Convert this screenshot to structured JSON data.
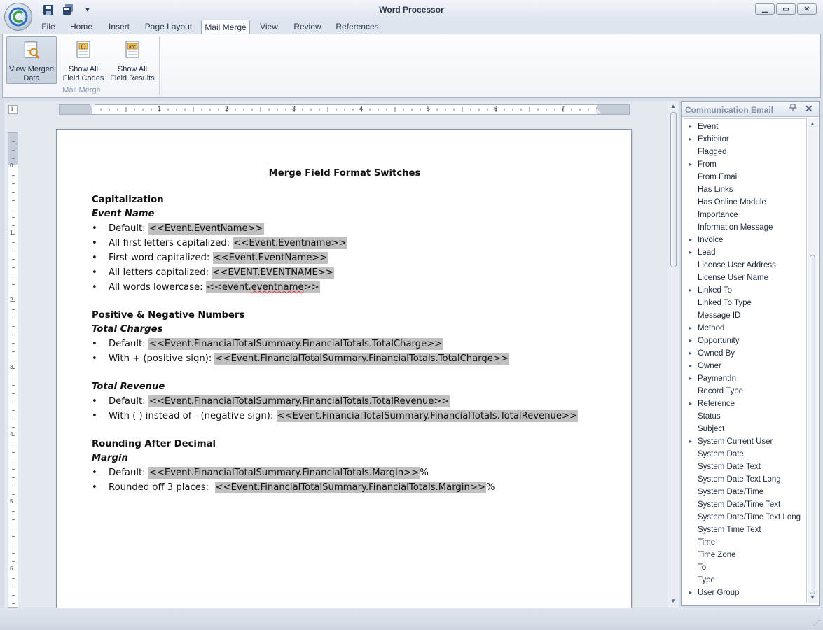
{
  "app": {
    "title": "Word Processor"
  },
  "tabs": [
    {
      "label": "File"
    },
    {
      "label": "Home"
    },
    {
      "label": "Insert"
    },
    {
      "label": "Page Layout"
    },
    {
      "label": "Mail Merge"
    },
    {
      "label": "View"
    },
    {
      "label": "Review"
    },
    {
      "label": "References"
    }
  ],
  "active_tab": "Mail Merge",
  "ribbon": {
    "group_label": "Mail Merge",
    "buttons": [
      {
        "line1": "View Merged",
        "line2": "Data"
      },
      {
        "line1": "Show All",
        "line2": "Field Codes"
      },
      {
        "line1": "Show All",
        "line2": "Field Results"
      }
    ]
  },
  "ruler": {
    "h_numbers": [
      "1",
      "2",
      "3",
      "4",
      "5",
      "6",
      "7"
    ],
    "v_numbers": [
      "0",
      "1",
      "2",
      "3",
      "4",
      "5",
      "6"
    ],
    "corner": "L"
  },
  "document": {
    "title": "Merge Field Format Switches",
    "sections": [
      {
        "heading": "Capitalization",
        "subheading": "Event Name",
        "bullets": [
          {
            "text": "Default: ",
            "field": "<<Event.EventName>>",
            "suffix": ""
          },
          {
            "text": "All first letters capitalized: ",
            "field": "<<Event.Eventname>>",
            "suffix": ""
          },
          {
            "text": "First word capitalized: ",
            "field": "<<Event.EventName>>",
            "suffix": ""
          },
          {
            "text": "All letters capitalized: ",
            "field": "<<EVENT.EVENTNAME>>",
            "suffix": ""
          },
          {
            "text": "All words lowercase: ",
            "field_pre": "<<event.",
            "field_err": "eventname",
            "field_post": ">>",
            "suffix": ""
          }
        ]
      },
      {
        "heading": "Positive & Negative Numbers",
        "subheading": "Total Charges",
        "bullets": [
          {
            "text": "Default: ",
            "field": "<<Event.FinancialTotalSummary.FinancialTotals.TotalCharge>>",
            "suffix": ""
          },
          {
            "text": "With + (positive sign): ",
            "field": "<<Event.FinancialTotalSummary.FinancialTotals.TotalCharge>>",
            "suffix": ""
          }
        ]
      },
      {
        "heading": "",
        "subheading": "Total Revenue",
        "bullets": [
          {
            "text": "Default: ",
            "field": "<<Event.FinancialTotalSummary.FinancialTotals.TotalRevenue>>",
            "suffix": ""
          },
          {
            "text": "With ( ) instead of - (negative sign): ",
            "field": "<<Event.FinancialTotalSummary.FinancialTotals.TotalRevenue>>",
            "suffix": ""
          }
        ]
      },
      {
        "heading": "Rounding After Decimal",
        "subheading": "Margin",
        "bullets": [
          {
            "text": "Default: ",
            "field": "<<Event.FinancialTotalSummary.FinancialTotals.Margin>>",
            "suffix": "%"
          },
          {
            "text": "Rounded off 3 places:  ",
            "field": "<<Event.FinancialTotalSummary.FinancialTotals.Margin>>",
            "suffix": "%"
          }
        ]
      }
    ],
    "bullet_glyph": "•"
  },
  "panel": {
    "title": "Communication Email",
    "items": [
      {
        "label": "Event",
        "expandable": true
      },
      {
        "label": "Exhibitor",
        "expandable": true
      },
      {
        "label": "Flagged",
        "expandable": false
      },
      {
        "label": "From",
        "expandable": true
      },
      {
        "label": "From Email",
        "expandable": false
      },
      {
        "label": "Has Links",
        "expandable": false
      },
      {
        "label": "Has Online Module",
        "expandable": false
      },
      {
        "label": "Importance",
        "expandable": false
      },
      {
        "label": "Information Message",
        "expandable": false
      },
      {
        "label": "Invoice",
        "expandable": true
      },
      {
        "label": "Lead",
        "expandable": true
      },
      {
        "label": "License User Address",
        "expandable": false
      },
      {
        "label": "License User Name",
        "expandable": false
      },
      {
        "label": "Linked To",
        "expandable": true
      },
      {
        "label": "Linked To Type",
        "expandable": false
      },
      {
        "label": "Message ID",
        "expandable": false
      },
      {
        "label": "Method",
        "expandable": true
      },
      {
        "label": "Opportunity",
        "expandable": true
      },
      {
        "label": "Owned By",
        "expandable": true
      },
      {
        "label": "Owner",
        "expandable": true
      },
      {
        "label": "PaymentIn",
        "expandable": true
      },
      {
        "label": "Record Type",
        "expandable": false
      },
      {
        "label": "Reference",
        "expandable": true
      },
      {
        "label": "Status",
        "expandable": false
      },
      {
        "label": "Subject",
        "expandable": false
      },
      {
        "label": "System Current User",
        "expandable": true
      },
      {
        "label": "System Date",
        "expandable": false
      },
      {
        "label": "System Date Text",
        "expandable": false
      },
      {
        "label": "System Date Text Long",
        "expandable": false
      },
      {
        "label": "System Date/Time",
        "expandable": false
      },
      {
        "label": "System Date/Time Text",
        "expandable": false
      },
      {
        "label": "System Date/Time Text Long",
        "expandable": false
      },
      {
        "label": "System Time Text",
        "expandable": false
      },
      {
        "label": "Time",
        "expandable": false
      },
      {
        "label": "Time Zone",
        "expandable": false
      },
      {
        "label": "To",
        "expandable": false
      },
      {
        "label": "Type",
        "expandable": false
      },
      {
        "label": "User Group",
        "expandable": true
      }
    ]
  },
  "icons": {
    "app_orb": "app-logo-icon",
    "save": "save-icon",
    "save_all": "save-all-icon",
    "qat_dropdown": "dropdown-arrow-icon",
    "expand": "▸",
    "pin": "pin-icon",
    "close": "✕"
  },
  "colors": {
    "field_highlight": "#c0c0c0",
    "accent": "#1f6fc0"
  }
}
